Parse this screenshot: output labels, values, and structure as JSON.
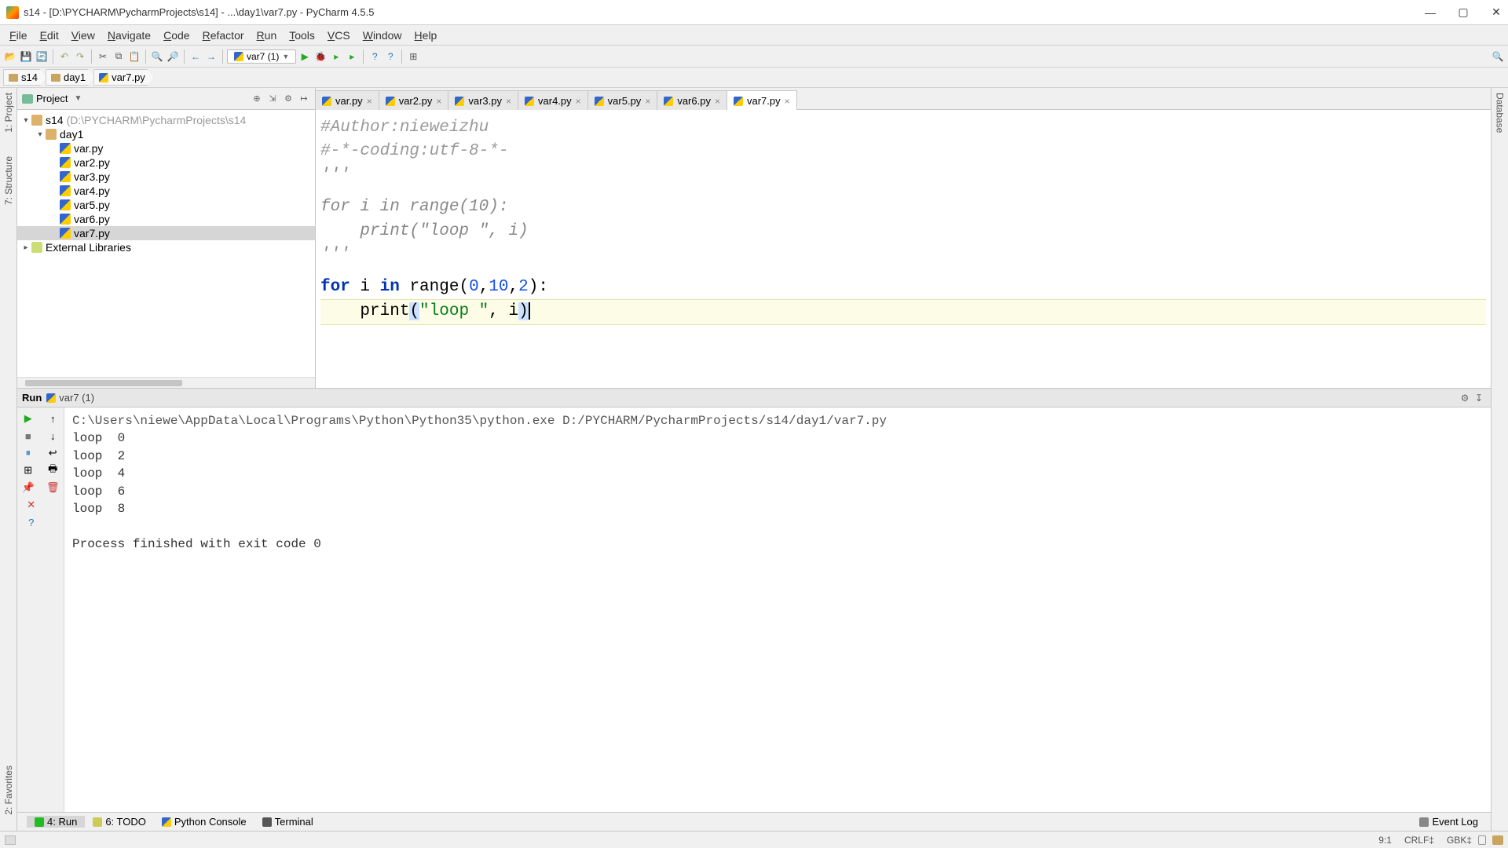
{
  "titlebar": {
    "text": "s14 - [D:\\PYCHARM\\PycharmProjects\\s14] - ...\\day1\\var7.py - PyCharm 4.5.5"
  },
  "menubar": [
    {
      "label": "File",
      "u": "F"
    },
    {
      "label": "Edit",
      "u": "E"
    },
    {
      "label": "View",
      "u": "V"
    },
    {
      "label": "Navigate",
      "u": "N"
    },
    {
      "label": "Code",
      "u": "C"
    },
    {
      "label": "Refactor",
      "u": "R"
    },
    {
      "label": "Run",
      "u": "R"
    },
    {
      "label": "Tools",
      "u": "T"
    },
    {
      "label": "VCS",
      "u": "V"
    },
    {
      "label": "Window",
      "u": "W"
    },
    {
      "label": "Help",
      "u": "H"
    }
  ],
  "toolbar": {
    "run_config_label": "var7 (1)"
  },
  "breadcrumbs": [
    {
      "type": "dir",
      "label": "s14"
    },
    {
      "type": "dir",
      "label": "day1"
    },
    {
      "type": "py",
      "label": "var7.py"
    }
  ],
  "project": {
    "title": "Project",
    "root_name": "s14",
    "root_path": "(D:\\PYCHARM\\PycharmProjects\\s14",
    "folder": "day1",
    "files": [
      "var.py",
      "var2.py",
      "var3.py",
      "var4.py",
      "var5.py",
      "var6.py",
      "var7.py"
    ],
    "selected": "var7.py",
    "ext_libs": "External Libraries"
  },
  "tabs": [
    {
      "label": "var.py",
      "active": false
    },
    {
      "label": "var2.py",
      "active": false
    },
    {
      "label": "var3.py",
      "active": false
    },
    {
      "label": "var4.py",
      "active": false
    },
    {
      "label": "var5.py",
      "active": false
    },
    {
      "label": "var6.py",
      "active": false
    },
    {
      "label": "var7.py",
      "active": true
    }
  ],
  "code": {
    "l1": "#Author:nieweizhu",
    "l2": "#-*-coding:utf-8-*-",
    "l3": "'''",
    "l4": "for i in range(10):",
    "l5": "    print(\"loop \", i)",
    "l6": "'''",
    "l7_for": "for",
    "l7_i": " i ",
    "l7_in": "in",
    "l7_range": " range",
    "l7_open": "(",
    "l7_a": "0",
    "l7_c1": ",",
    "l7_b": "10",
    "l7_c2": ",",
    "l7_c": "2",
    "l7_close": "):",
    "l8_ind": "    ",
    "l8_print": "print",
    "l8_open": "(",
    "l8_str": "\"loop \"",
    "l8_cm": ", i",
    "l8_close": ")"
  },
  "run": {
    "label": "Run",
    "config": "var7 (1)",
    "cmd": "C:\\Users\\niewe\\AppData\\Local\\Programs\\Python\\Python35\\python.exe D:/PYCHARM/PycharmProjects/s14/day1/var7.py",
    "out": [
      "loop  0",
      "loop  2",
      "loop  4",
      "loop  6",
      "loop  8"
    ],
    "exit": "Process finished with exit code 0"
  },
  "side_tabs_left": [
    {
      "label": "1: Project"
    },
    {
      "label": "7: Structure"
    },
    {
      "label": "2: Favorites"
    }
  ],
  "side_tabs_right": [
    {
      "label": "Database"
    }
  ],
  "bottom_tabs": [
    {
      "label": "4: Run",
      "icon": "run-i",
      "active": true
    },
    {
      "label": "6: TODO",
      "icon": "todo-i"
    },
    {
      "label": "Python Console",
      "icon": "py-i"
    },
    {
      "label": "Terminal",
      "icon": "term-i"
    }
  ],
  "event_log": "Event Log",
  "status": {
    "pos": "9:1",
    "eol": "CRLF‡",
    "enc": "GBK‡"
  }
}
